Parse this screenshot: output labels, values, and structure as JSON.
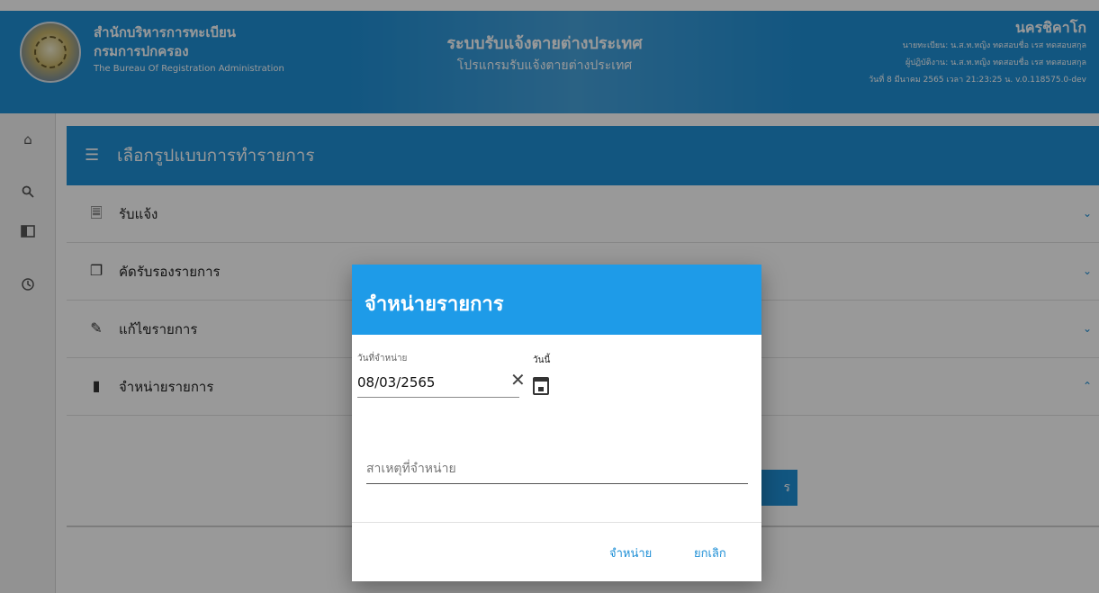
{
  "header": {
    "org_name": "สำนักบริหารการทะเบียน",
    "dept_name": "กรมการปกครอง",
    "org_name_en": "The Bureau Of Registration Administration",
    "system_title": "ระบบรับแจ้งตายต่างประเทศ",
    "program_title": "โปรแกรมรับแจ้งตายต่างประเทศ",
    "city": "นครชิคาโก",
    "registrar": "นายทะเบียน: น.ส.ท.หญิง ทดสอบชื่อ เรส ทดสอบสกุล",
    "operator": "ผู้ปฏิบัติงาน: น.ส.ท.หญิง ทดสอบชื่อ เรส ทดสอบสกุล",
    "datetime_version": "วันที่ 8 มีนาคม 2565 เวลา 21:23:25 น. v.0.118575.0-dev"
  },
  "sidebar": {
    "icons": [
      "home-icon",
      "search-icon",
      "book-icon",
      "history-icon"
    ]
  },
  "panel": {
    "title": "เลือกรูปแบบการทำรายการ",
    "items": [
      {
        "label": "รับแจ้ง",
        "icon": "document-icon",
        "expanded": false
      },
      {
        "label": "คัดรับรองรายการ",
        "icon": "copy-icon",
        "expanded": false
      },
      {
        "label": "แก้ไขรายการ",
        "icon": "edit-icon",
        "expanded": false
      },
      {
        "label": "จำหน่ายรายการ",
        "icon": "trash-icon",
        "expanded": true
      }
    ],
    "background_button": "ร"
  },
  "dialog": {
    "title": "จำหน่ายรายการ",
    "date_label": "วันที่จำหน่าย",
    "date_value": "08/03/2565",
    "today_label": "วันนี้",
    "reason_placeholder": "สาเหตุที่จำหน่าย",
    "confirm_label": "จำหน่าย",
    "cancel_label": "ยกเลิก"
  },
  "colors": {
    "primary": "#1e8fd6",
    "dialog_header": "#1e9be8"
  }
}
